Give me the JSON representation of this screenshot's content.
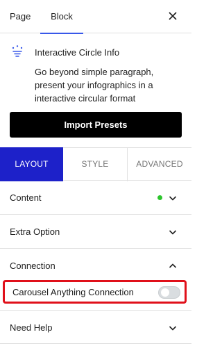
{
  "header": {
    "tabs": [
      {
        "label": "Page",
        "active": false
      },
      {
        "label": "Block",
        "active": true
      }
    ],
    "close_icon": "close-icon"
  },
  "block": {
    "icon": "circle-info-icon",
    "title": "Interactive Circle Info",
    "description": "Go beyond simple paragraph, present your infographics in a interactive circular format"
  },
  "import_button": {
    "label": "Import Presets"
  },
  "section_tabs": [
    {
      "label": "LAYOUT",
      "active": true
    },
    {
      "label": "STYLE",
      "active": false
    },
    {
      "label": "ADVANCED",
      "active": false
    }
  ],
  "panels": [
    {
      "label": "Content",
      "expanded": false,
      "status_dot": true
    },
    {
      "label": "Extra Option",
      "expanded": false
    },
    {
      "label": "Connection",
      "expanded": true
    },
    {
      "label": "Need Help",
      "expanded": false
    }
  ],
  "connection": {
    "toggle_label": "Carousel Anything Connection",
    "toggle_on": false
  },
  "colors": {
    "accent_tab": "#1d21c9",
    "underline": "#3858e9",
    "status_dot": "#2dc52d",
    "highlight": "#e0101a"
  }
}
